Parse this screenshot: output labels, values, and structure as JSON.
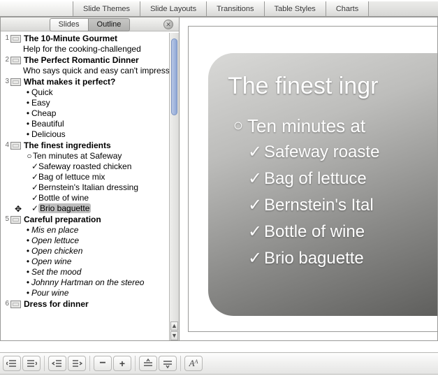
{
  "tabs": {
    "slide_themes": "Slide Themes",
    "slide_layouts": "Slide Layouts",
    "transitions": "Transitions",
    "table_styles": "Table Styles",
    "charts": "Charts"
  },
  "sidebar_header": {
    "slides_tab": "Slides",
    "outline_tab": "Outline",
    "active_tab": "Outline"
  },
  "outline": [
    {
      "n": 1,
      "title": "The 10-Minute Gourmet",
      "body": "Help for the cooking-challenged"
    },
    {
      "n": 2,
      "title": "The Perfect Romantic Dinner",
      "body": "Who says quick and easy can't impress?"
    },
    {
      "n": 3,
      "title": "What makes it perfect?",
      "bullets": [
        {
          "mark": "•",
          "text": "Quick"
        },
        {
          "mark": "•",
          "text": "Easy"
        },
        {
          "mark": "•",
          "text": "Cheap"
        },
        {
          "mark": "•",
          "text": "Beautiful"
        },
        {
          "mark": "•",
          "text": "Delicious"
        }
      ]
    },
    {
      "n": 4,
      "title": "The finest ingredients",
      "bullets": [
        {
          "mark": "○",
          "level": 2,
          "text": "Ten minutes at Safeway"
        },
        {
          "mark": "✓",
          "level": 3,
          "text": "Safeway roasted chicken"
        },
        {
          "mark": "✓",
          "level": 3,
          "text": "Bag of lettuce mix"
        },
        {
          "mark": "✓",
          "level": 3,
          "text": "Bernstein's Italian dressing"
        },
        {
          "mark": "✓",
          "level": 3,
          "text": "Bottle of wine"
        },
        {
          "mark": "✓",
          "level": 3,
          "text": "Brio baguette",
          "selected": true
        }
      ]
    },
    {
      "n": 5,
      "title": "Careful preparation",
      "bullets": [
        {
          "mark": "•",
          "text": "Mis en place",
          "italic": true
        },
        {
          "mark": "•",
          "text": "Open lettuce",
          "italic": true
        },
        {
          "mark": "•",
          "text": "Open chicken",
          "italic": true
        },
        {
          "mark": "•",
          "text": "Open wine",
          "italic": true
        },
        {
          "mark": "•",
          "text": "Set the mood",
          "italic": true
        },
        {
          "mark": "•",
          "text": "Johnny Hartman on the stereo",
          "italic": true
        },
        {
          "mark": "•",
          "text": "Pour wine",
          "italic": true
        }
      ]
    },
    {
      "n": 6,
      "title": "Dress for dinner"
    }
  ],
  "slide_preview": {
    "title": "The finest ingr",
    "rows": [
      {
        "mark": "○",
        "text": "Ten minutes at"
      },
      {
        "mark": "✓",
        "text": "Safeway roaste",
        "sub": true
      },
      {
        "mark": "✓",
        "text": "Bag of lettuce",
        "sub": true
      },
      {
        "mark": "✓",
        "text": "Bernstein's Ital",
        "sub": true
      },
      {
        "mark": "✓",
        "text": "Bottle of wine",
        "sub": true
      },
      {
        "mark": "✓",
        "text": "Brio baguette",
        "sub": true
      }
    ]
  },
  "toolbar": {
    "outdent": "Promote",
    "indent": "Demote",
    "move_left": "Move left",
    "move_right": "Move right",
    "collapse": "Collapse",
    "expand": "Expand",
    "move_up": "Move up",
    "move_down": "Move down",
    "formatting": "Show formatting"
  }
}
